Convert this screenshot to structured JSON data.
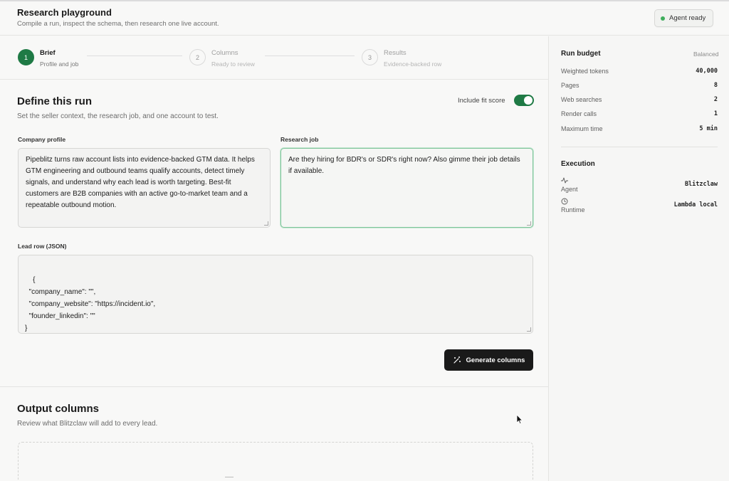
{
  "header": {
    "title": "Research playground",
    "subtitle": "Compile a run, inspect the schema, then research one live account.",
    "agent_status": "Agent ready",
    "agent_status_color": "#3fae5c"
  },
  "stepper": {
    "steps": [
      {
        "number": "1",
        "title": "Brief",
        "subtitle": "Profile and job"
      },
      {
        "number": "2",
        "title": "Columns",
        "subtitle": "Ready to review"
      },
      {
        "number": "3",
        "title": "Results",
        "subtitle": "Evidence-backed row"
      }
    ],
    "active_step": 1
  },
  "define": {
    "title": "Define this run",
    "description": "Set the seller context, the research job, and one account to test.",
    "fit_score_label": "Include fit score",
    "fit_score_enabled": true,
    "company_profile_label": "Company profile",
    "company_profile_value": "Pipeblitz turns raw account lists into evidence-backed GTM data. It helps GTM engineering and outbound teams qualify accounts, detect timely signals, and understand why each lead is worth targeting. Best-fit customers are B2B companies with an active go-to-market team and a repeatable outbound motion.",
    "research_job_label": "Research job",
    "research_job_value": "Are they hiring for BDR's or SDR's right now? Also gimme their job details if available.",
    "lead_row_label": "Lead row (JSON)",
    "lead_row_value": "{\n  \"company_name\": \"\",\n  \"company_website\": \"https://incident.io\",\n  \"founder_linkedin\": \"\"\n}",
    "generate_button": "Generate columns"
  },
  "output": {
    "title": "Output columns",
    "description": "Review what Blitzclaw will add to every lead."
  },
  "budget": {
    "title": "Run budget",
    "mode": "Balanced",
    "rows": [
      {
        "label": "Weighted tokens",
        "value": "40,000"
      },
      {
        "label": "Pages",
        "value": "8"
      },
      {
        "label": "Web searches",
        "value": "2"
      },
      {
        "label": "Render calls",
        "value": "1"
      },
      {
        "label": "Maximum time",
        "value": "5 min"
      }
    ]
  },
  "execution": {
    "title": "Execution",
    "agent_label": "Agent",
    "agent_value": "Blitzclaw",
    "runtime_label": "Runtime",
    "runtime_value": "Lambda local"
  },
  "colors": {
    "accent": "#1f7a45",
    "button_dark": "#1a1a1a"
  }
}
